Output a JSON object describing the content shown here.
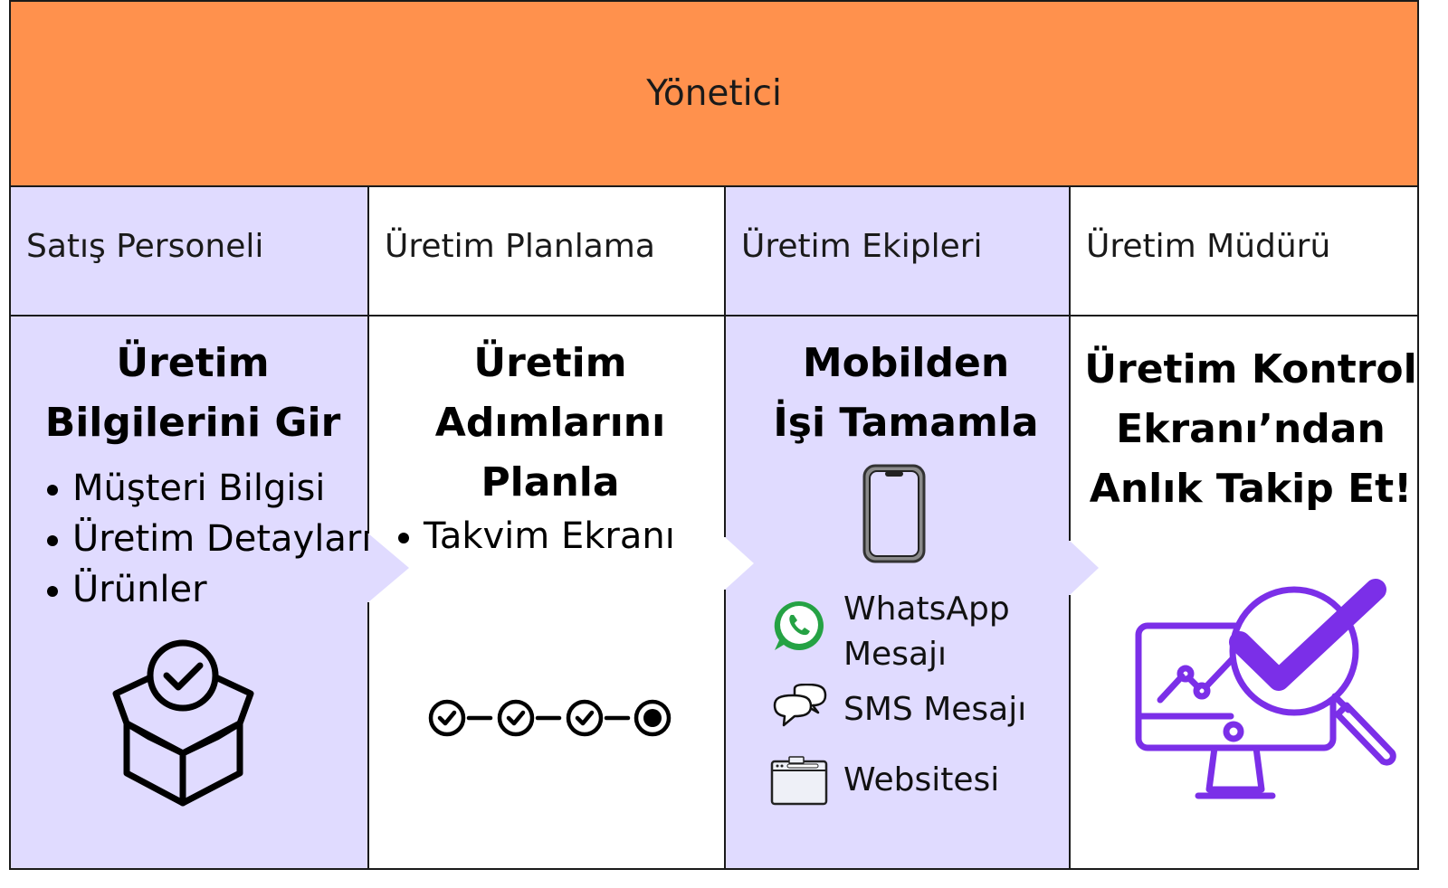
{
  "header": {
    "title": "Yönetici"
  },
  "roles": [
    {
      "label": "Satış Personeli"
    },
    {
      "label": "Üretim Planlama"
    },
    {
      "label": "Üretim Ekipleri"
    },
    {
      "label": "Üretim Müdürü"
    }
  ],
  "steps": [
    {
      "title_lines": [
        "Üretim",
        "Bilgilerini Gir"
      ],
      "items": [
        "Müşteri Bilgisi",
        "Üretim Detayları",
        "Ürünler"
      ],
      "icon": "box-check-icon"
    },
    {
      "title_lines": [
        "Üretim",
        "Adımlarını",
        "Planla"
      ],
      "items": [
        "Takvim Ekranı"
      ],
      "icon": "progress-steps-icon"
    },
    {
      "title_lines": [
        "Mobilden",
        "İşi Tamamla"
      ],
      "icon": "mobile-phone-icon",
      "channels": [
        {
          "label_lines": [
            "WhatsApp",
            "Mesajı"
          ],
          "icon": "whatsapp-icon"
        },
        {
          "label_lines": [
            "SMS Mesajı"
          ],
          "icon": "sms-bubbles-icon"
        },
        {
          "label_lines": [
            "Websitesi"
          ],
          "icon": "browser-window-icon"
        }
      ]
    },
    {
      "title_lines": [
        "Üretim Kontrol",
        "Ekranı’ndan",
        "Anlık Takip Et!"
      ],
      "icon": "monitor-magnifier-check-icon"
    }
  ],
  "colors": {
    "header": "#ff914d",
    "lavender": "#e0dbff",
    "purple_icon": "#7b2fe8",
    "whatsapp_green": "#25a244"
  }
}
